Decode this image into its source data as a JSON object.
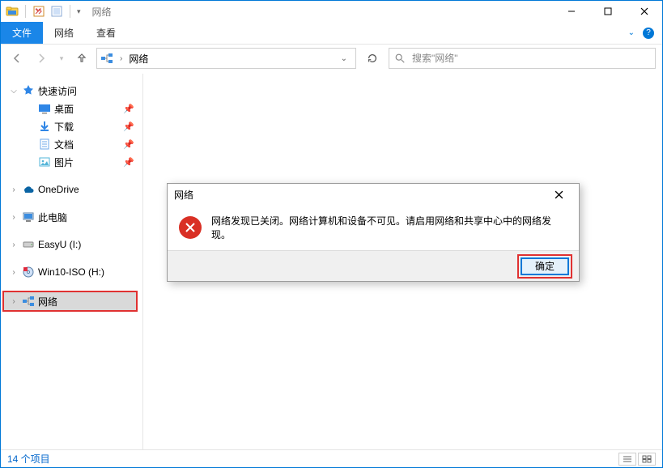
{
  "window": {
    "title": "网络"
  },
  "ribbon": {
    "file": "文件",
    "tab_network": "网络",
    "tab_view": "查看"
  },
  "nav": {
    "address": "网络",
    "search_placeholder": "搜索\"网络\""
  },
  "sidebar": {
    "quick_access": "快速访问",
    "desktop": "桌面",
    "downloads": "下载",
    "documents": "文档",
    "pictures": "图片",
    "onedrive": "OneDrive",
    "this_pc": "此电脑",
    "easyu": "EasyU (I:)",
    "win10iso": "Win10-ISO (H:)",
    "network": "网络"
  },
  "dialog": {
    "title": "网络",
    "message": "网络发现已关闭。网络计算机和设备不可见。请启用网络和共享中心中的网络发现。",
    "ok": "确定"
  },
  "status": {
    "items": "14 个项目"
  }
}
